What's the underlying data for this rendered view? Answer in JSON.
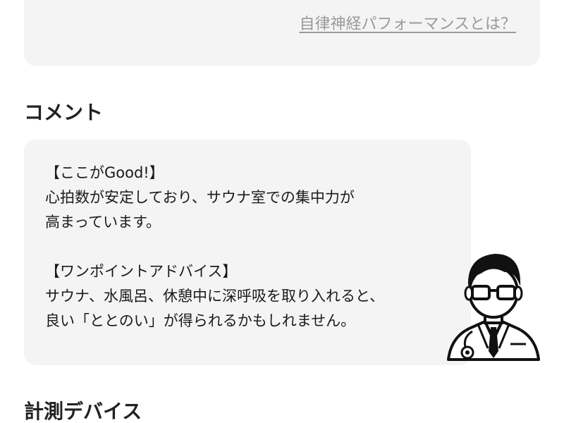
{
  "info": {
    "link_label": "自律神経パフォーマンスとは？"
  },
  "comment": {
    "heading": "コメント",
    "good_title": "【ここがGood!】",
    "good_lines": [
      "心拍数が安定しており、サウナ室での集中力が",
      "高まっています。"
    ],
    "advice_title": "【ワンポイントアドバイス】",
    "advice_lines": [
      "サウナ、水風呂、休憩中に深呼吸を取り入れると、",
      "良い「ととのい」が得られるかもしれません。"
    ],
    "avatar_icon": "doctor-icon"
  },
  "device": {
    "heading": "計測デバイス"
  }
}
